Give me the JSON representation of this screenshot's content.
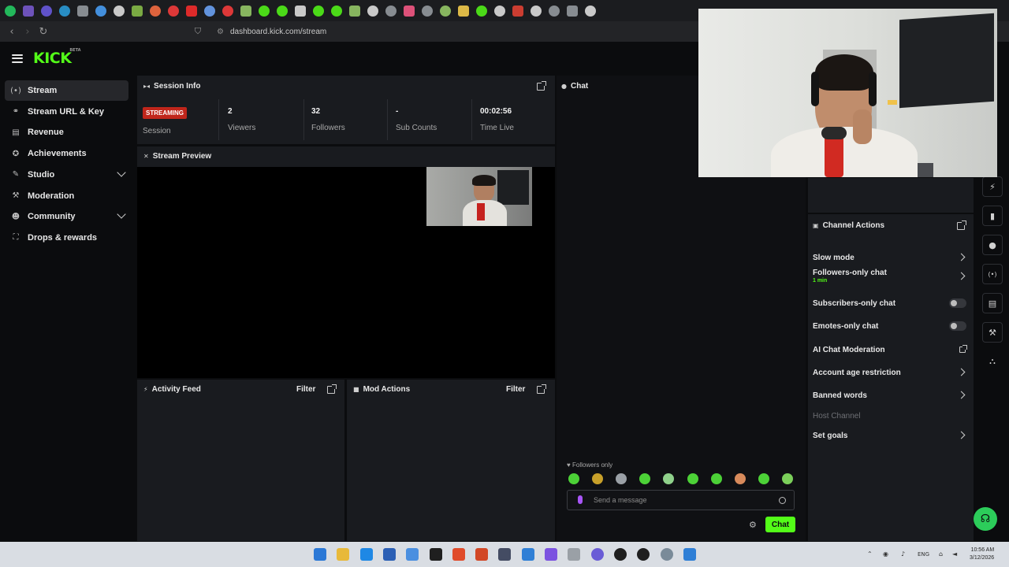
{
  "browser": {
    "url": "dashboard.kick.com/stream",
    "tab_icon_colors": [
      "#25d366",
      "#7b5cd6",
      "#6c5ce7",
      "#2aa1e0",
      "#9aa0a6",
      "#4aa3ff",
      "#e8e8e8",
      "#8bc34a",
      "#ff7043",
      "#ff3d3d",
      "#ff2d2d",
      "#6fa8ff",
      "#ff3d3d",
      "#9ad06b",
      "#53fc18",
      "#53fc18",
      "#e8e8e8",
      "#53fc18",
      "#53fc18",
      "#9ad06b",
      "#e8e8e8",
      "#9aa0a6",
      "#ff5a8a",
      "#9aa0a6",
      "#9ad06b",
      "#ffd54f",
      "#53fc18",
      "#e8e8e8",
      "#ea4335",
      "#e8e8e8",
      "#9aa0a6",
      "#9aa0a6",
      "#e8e8e8"
    ]
  },
  "brand": {
    "logo": "KICK",
    "logo_tag": "BETA",
    "accent": "#53fc18"
  },
  "sidebar": {
    "items": [
      {
        "label": "Stream",
        "icon": "stream-icon",
        "glyph": "(•)",
        "active": true
      },
      {
        "label": "Stream URL & Key",
        "icon": "link-icon",
        "glyph": "⚭"
      },
      {
        "label": "Revenue",
        "icon": "revenue-icon",
        "glyph": "▤"
      },
      {
        "label": "Achievements",
        "icon": "achievements-icon",
        "glyph": "✪"
      },
      {
        "label": "Studio",
        "icon": "studio-icon",
        "glyph": "✎",
        "expandable": true
      },
      {
        "label": "Moderation",
        "icon": "wrench-icon",
        "glyph": "⚒"
      },
      {
        "label": "Community",
        "icon": "community-icon",
        "glyph": "☻",
        "expandable": true
      },
      {
        "label": "Drops & rewards",
        "icon": "drops-icon",
        "glyph": "⛶"
      }
    ]
  },
  "session": {
    "title": "Session Info",
    "status_badge": "STREAMING",
    "status_label": "Session",
    "stats": [
      {
        "value": "2",
        "label": "Viewers"
      },
      {
        "value": "32",
        "label": "Followers"
      },
      {
        "value": "-",
        "label": "Sub Counts"
      },
      {
        "value": "00:02:56",
        "label": "Time Live"
      }
    ]
  },
  "preview": {
    "title": "Stream Preview"
  },
  "activity": {
    "title": "Activity Feed",
    "filter": "Filter"
  },
  "mod_actions": {
    "title": "Mod Actions",
    "filter": "Filter"
  },
  "chat": {
    "title": "Chat",
    "mode_note": "Followers only",
    "placeholder": "Send a message",
    "send_label": "Chat",
    "emote_colors": [
      "#4cd137",
      "#c8a02a",
      "#9aa0a6",
      "#4cd137",
      "#8fd18b",
      "#4cd137",
      "#4cd137",
      "#d88a5b",
      "#4cd137",
      "#7bcf5a"
    ]
  },
  "channel_actions": {
    "title": "Channel Actions",
    "rows": [
      {
        "label": "Slow mode",
        "control": "arrow"
      },
      {
        "label": "Followers-only chat",
        "sub": "1 min",
        "control": "arrow"
      },
      {
        "label": "Subscribers-only chat",
        "control": "toggle"
      },
      {
        "label": "Emotes-only chat",
        "control": "toggle"
      },
      {
        "label": "AI Chat Moderation",
        "control": "popout"
      },
      {
        "label": "Account age restriction",
        "control": "arrow"
      },
      {
        "label": "Banned words",
        "control": "arrow"
      },
      {
        "label": "Host Channel",
        "control": "none",
        "disabled": true
      },
      {
        "label": "Set goals",
        "control": "arrow"
      }
    ]
  },
  "taskbar": {
    "lang": "ENG",
    "time": "10:56 AM",
    "date": "3/12/2026",
    "app_colors": [
      "#2b78d6",
      "#e8b93a",
      "#1e88e5",
      "#2b5fb5",
      "#4a8fe0",
      "#1f1f1f",
      "#e04b2a",
      "#d24726",
      "#444c63",
      "#2f7fd6",
      "#7b52e0",
      "#9aa0a6",
      "#6a5cd6",
      "#1f1f1f",
      "#1f1f1f",
      "#7a8b99",
      "#2f7fd6"
    ]
  }
}
